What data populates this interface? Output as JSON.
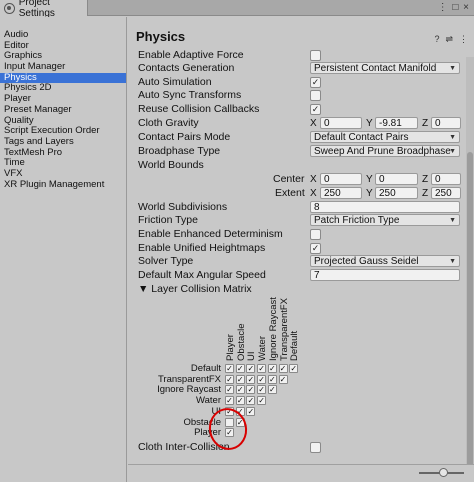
{
  "window": {
    "tab_title": "Project Settings",
    "menu_glyph": "⋮ □ ×"
  },
  "sidebar": {
    "items": [
      {
        "label": "Audio"
      },
      {
        "label": "Editor"
      },
      {
        "label": "Graphics"
      },
      {
        "label": "Input Manager"
      },
      {
        "label": "Physics",
        "active": true
      },
      {
        "label": "Physics 2D"
      },
      {
        "label": "Player"
      },
      {
        "label": "Preset Manager"
      },
      {
        "label": "Quality"
      },
      {
        "label": "Script Execution Order"
      },
      {
        "label": "Tags and Layers"
      },
      {
        "label": "TextMesh Pro"
      },
      {
        "label": "Time"
      },
      {
        "label": "VFX"
      },
      {
        "label": "XR Plugin Management"
      }
    ]
  },
  "main": {
    "title": "Physics",
    "header_icons": [
      "help-icon",
      "preset-icon",
      "more-icon"
    ],
    "header_glyphs": [
      "?",
      "⇌",
      "⋮"
    ],
    "settings": {
      "enable_adaptive_force": {
        "label": "Enable Adaptive Force",
        "checked": false
      },
      "contacts_generation": {
        "label": "Contacts Generation",
        "value": "Persistent Contact Manifold"
      },
      "auto_simulation": {
        "label": "Auto Simulation",
        "checked": true
      },
      "auto_sync_transforms": {
        "label": "Auto Sync Transforms",
        "checked": false
      },
      "reuse_collision_callbacks": {
        "label": "Reuse Collision Callbacks",
        "checked": true
      },
      "cloth_gravity": {
        "label": "Cloth Gravity",
        "x": "0",
        "y": "-9.81",
        "z": "0"
      },
      "contact_pairs_mode": {
        "label": "Contact Pairs Mode",
        "value": "Default Contact Pairs"
      },
      "broadphase_type": {
        "label": "Broadphase Type",
        "value": "Sweep And Prune Broadphase"
      },
      "world_bounds": {
        "label": "World Bounds",
        "center_label": "Center",
        "extent_label": "Extent",
        "center": {
          "x": "0",
          "y": "0",
          "z": "0"
        },
        "extent": {
          "x": "250",
          "y": "250",
          "z": "250"
        }
      },
      "world_subdivisions": {
        "label": "World Subdivisions",
        "value": "8"
      },
      "friction_type": {
        "label": "Friction Type",
        "value": "Patch Friction Type"
      },
      "enable_enhanced_determinism": {
        "label": "Enable Enhanced Determinism",
        "checked": false
      },
      "enable_unified_heightmaps": {
        "label": "Enable Unified Heightmaps",
        "checked": true
      },
      "solver_type": {
        "label": "Solver Type",
        "value": "Projected Gauss Seidel"
      },
      "default_max_angular_speed": {
        "label": "Default Max Angular Speed",
        "value": "7"
      },
      "layer_collision_matrix": {
        "label": "▼ Layer Collision Matrix"
      },
      "cloth_inter_collision": {
        "label": "Cloth Inter-Collision",
        "checked": false
      }
    },
    "axis_labels": {
      "x": "X",
      "y": "Y",
      "z": "Z"
    },
    "check_glyph": "✓"
  },
  "matrix": {
    "column_layers": [
      "Player",
      "Obstacle",
      "UI",
      "Water",
      "Ignore Raycast",
      "TransparentFX",
      "Default"
    ],
    "row_layers": [
      "Default",
      "TransparentFX",
      "Ignore Raycast",
      "Water",
      "UI",
      "Obstacle",
      "Player"
    ],
    "rows_checked": [
      [
        true,
        true,
        true,
        true,
        true,
        true,
        true
      ],
      [
        true,
        true,
        true,
        true,
        true,
        true
      ],
      [
        true,
        true,
        true,
        true,
        true
      ],
      [
        true,
        true,
        true,
        true
      ],
      [
        true,
        true,
        true
      ],
      [
        false,
        true
      ],
      [
        true
      ]
    ]
  },
  "colors": {
    "accent": "#3a72d6",
    "annotation": "#d80000"
  }
}
